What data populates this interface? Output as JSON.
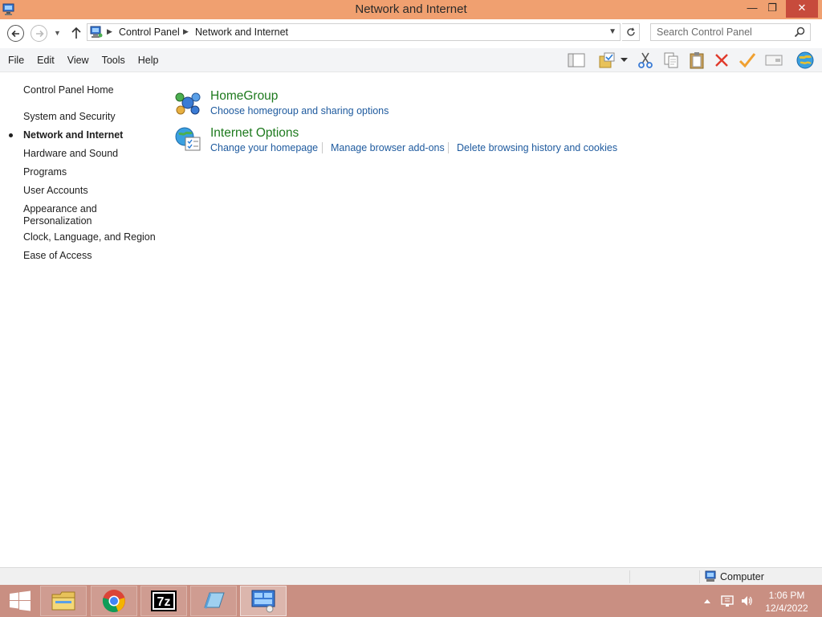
{
  "window": {
    "title": "Network and Internet",
    "controls": {
      "minimize": "—",
      "maximize": "❐",
      "close": "✕"
    }
  },
  "address": {
    "crumbs": [
      "Control Panel",
      "Network and Internet"
    ],
    "search_placeholder": "Search Control Panel"
  },
  "menu": [
    "File",
    "Edit",
    "View",
    "Tools",
    "Help"
  ],
  "toolbar": [
    "layout-pane-icon",
    "folder-check-icon",
    "dropdown-arrow-icon",
    "cut-icon",
    "copy-icon",
    "paste-icon",
    "delete-icon",
    "checkmark-icon",
    "properties-icon",
    "globe-icon"
  ],
  "sidebar": {
    "home": "Control Panel Home",
    "items": [
      {
        "label": "System and Security",
        "current": false
      },
      {
        "label": "Network and Internet",
        "current": true
      },
      {
        "label": "Hardware and Sound",
        "current": false
      },
      {
        "label": "Programs",
        "current": false
      },
      {
        "label": "User Accounts",
        "current": false
      },
      {
        "label": "Appearance and Personalization",
        "current": false
      },
      {
        "label": "Clock, Language, and Region",
        "current": false
      },
      {
        "label": "Ease of Access",
        "current": false
      }
    ]
  },
  "categories": [
    {
      "title": "HomeGroup",
      "icon": "homegroup-icon",
      "links": [
        "Choose homegroup and sharing options"
      ]
    },
    {
      "title": "Internet Options",
      "icon": "internet-options-icon",
      "links": [
        "Change your homepage",
        "Manage browser add-ons",
        "Delete browsing history and cookies"
      ]
    }
  ],
  "statusbar": {
    "location": "Computer"
  },
  "taskbar": {
    "apps": [
      "start-icon",
      "file-explorer-icon",
      "chrome-icon",
      "7zip-icon",
      "notepad-icon",
      "control-panel-icon"
    ],
    "active_app": "control-panel-icon",
    "zip_label": "7z",
    "time": "1:06 PM",
    "date": "12/4/2022"
  },
  "colors": {
    "titlebar": "#f0a070",
    "close": "#c74b3c",
    "taskbar": "#c98f82",
    "category_title": "#1e7a1e",
    "link": "#1e5a9e"
  }
}
